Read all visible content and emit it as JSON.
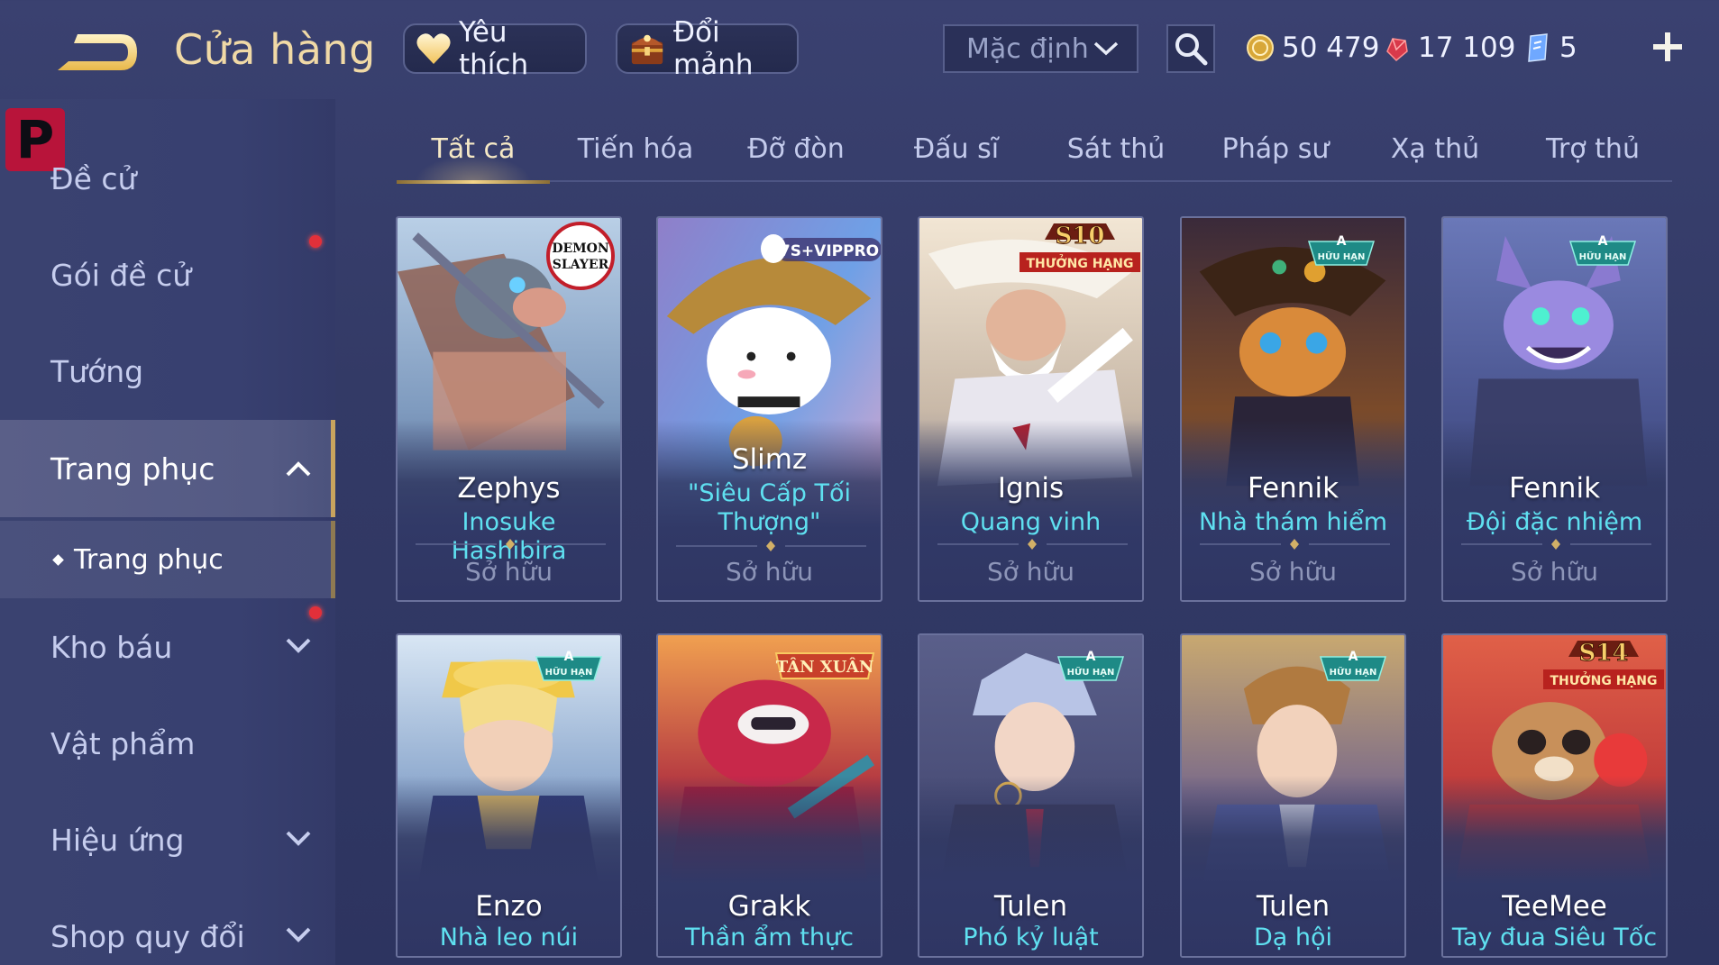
{
  "header": {
    "title": "Cửa hàng",
    "favorite_label": "Yêu thích",
    "shard_label": "Đổi mảnh",
    "sort_selected": "Mặc định"
  },
  "currencies": {
    "gold": "50 479",
    "ruby": "17 109",
    "voucher": "5"
  },
  "sidebar": {
    "items": [
      {
        "label": "Đề cử"
      },
      {
        "label": "Gói đề cử"
      },
      {
        "label": "Tướng"
      },
      {
        "label": "Trang phục"
      },
      {
        "label": "Trang phục"
      },
      {
        "label": "Kho báu"
      },
      {
        "label": "Vật phẩm"
      },
      {
        "label": "Hiệu ứng"
      },
      {
        "label": "Shop quy đổi"
      }
    ]
  },
  "tabs": [
    {
      "label": "Tất cả"
    },
    {
      "label": "Tiến hóa"
    },
    {
      "label": "Đỡ đòn"
    },
    {
      "label": "Đấu sĩ"
    },
    {
      "label": "Sát thủ"
    },
    {
      "label": "Pháp sư"
    },
    {
      "label": "Xạ thủ"
    },
    {
      "label": "Trợ thủ"
    }
  ],
  "cards": [
    {
      "hero": "Zephys",
      "skin": "Inosuke Hashibira",
      "status": "Sở hữu",
      "badge": "DEMON SLAYER"
    },
    {
      "hero": "Slimz",
      "skin": "\"Siêu Cấp Tối Thượng\"",
      "status": "Sở hữu",
      "badge": "7S+VIPPRO"
    },
    {
      "hero": "Ignis",
      "skin": "Quang vinh",
      "status": "Sở hữu",
      "badge_top": "S10",
      "badge_bottom": "THƯỞNG HẠNG"
    },
    {
      "hero": "Fennik",
      "skin": "Nhà thám hiểm",
      "status": "Sở hữu",
      "badge_top": "A",
      "badge_bottom": "HỮU HẠN"
    },
    {
      "hero": "Fennik",
      "skin": "Đội đặc nhiệm",
      "status": "Sở hữu",
      "badge_top": "A",
      "badge_bottom": "HỮU HẠN"
    },
    {
      "hero": "Enzo",
      "skin": "Nhà leo núi",
      "badge_top": "A",
      "badge_bottom": "HỮU HẠN"
    },
    {
      "hero": "Grakk",
      "skin": "Thần ẩm thực",
      "badge": "TÂN XUÂN"
    },
    {
      "hero": "Tulen",
      "skin": "Phó kỷ luật",
      "badge_top": "A",
      "badge_bottom": "HỮU HẠN"
    },
    {
      "hero": "Tulen",
      "skin": "Dạ hội",
      "badge_top": "A",
      "badge_bottom": "HỮU HẠN"
    },
    {
      "hero": "TeeMee",
      "skin": "Tay đua Siêu Tốc",
      "badge_top": "S14",
      "badge_bottom": "THƯỞNG HẠNG"
    }
  ],
  "colors": {
    "accent_gold": "#f0d9a6",
    "skin_name": "#5fe0f0",
    "notification": "#e2303a"
  }
}
